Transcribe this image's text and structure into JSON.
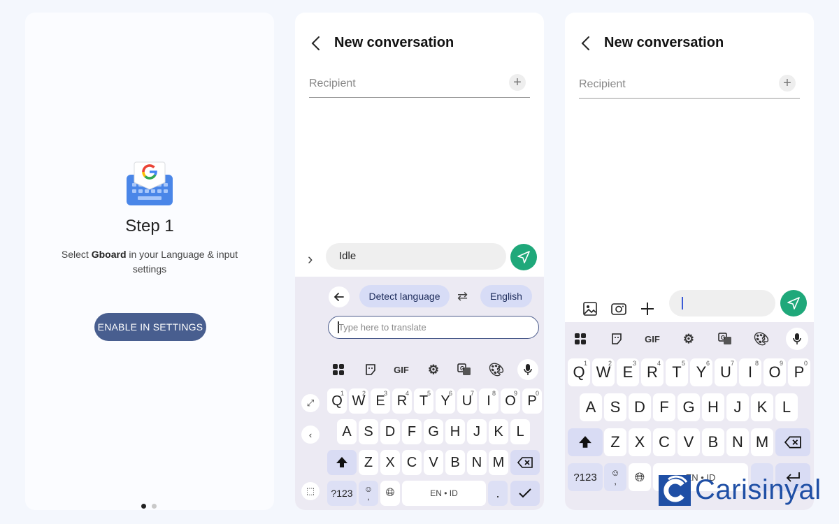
{
  "panel1": {
    "step_title": "Step 1",
    "desc_pre": "Select ",
    "desc_bold": "Gboard",
    "desc_post": " in your Language & input settings",
    "enable_button": "ENABLE IN SETTINGS",
    "logo_icon": "gboard-logo-icon",
    "page_dots": {
      "count": 2,
      "active": 1
    }
  },
  "panel2": {
    "title": "New conversation",
    "recipient_placeholder": "Recipient",
    "message_text": "Idle",
    "translate": {
      "source_chip": "Detect language",
      "target_chip": "English",
      "input_placeholder": "Type here to translate"
    },
    "toolbar": {
      "gif": "GIF"
    },
    "rows": [
      [
        "Q",
        "W",
        "E",
        "R",
        "T",
        "Y",
        "U",
        "I",
        "O",
        "P"
      ],
      [
        "A",
        "S",
        "D",
        "F",
        "G",
        "H",
        "J",
        "K",
        "L"
      ],
      [
        "Z",
        "X",
        "C",
        "V",
        "B",
        "N",
        "M"
      ]
    ],
    "numbers": [
      "1",
      "2",
      "3",
      "4",
      "5",
      "6",
      "7",
      "8",
      "9",
      "0"
    ],
    "bottom": {
      "sym": "?123",
      "emoji": "☺",
      "comma": ",",
      "space": "EN • ID",
      "period": "."
    }
  },
  "panel3": {
    "title": "New conversation",
    "recipient_placeholder": "Recipient",
    "toolbar": {
      "gif": "GIF"
    },
    "rows": [
      [
        "Q",
        "W",
        "E",
        "R",
        "T",
        "Y",
        "U",
        "I",
        "O",
        "P"
      ],
      [
        "A",
        "S",
        "D",
        "F",
        "G",
        "H",
        "J",
        "K",
        "L"
      ],
      [
        "Z",
        "X",
        "C",
        "V",
        "B",
        "N",
        "M"
      ]
    ],
    "numbers": [
      "1",
      "2",
      "3",
      "4",
      "5",
      "6",
      "7",
      "8",
      "9",
      "0"
    ],
    "bottom": {
      "sym": "?123",
      "emoji": "☺",
      "comma": ",",
      "space": "EN • ID"
    }
  },
  "watermark": {
    "text": "Carisinyal"
  },
  "colors": {
    "accent": "#485e8f",
    "send": "#1fa87a",
    "keyboard_bg": "#eceaf3",
    "chip": "#d7dcf6",
    "watermark": "#1f4fa5"
  }
}
